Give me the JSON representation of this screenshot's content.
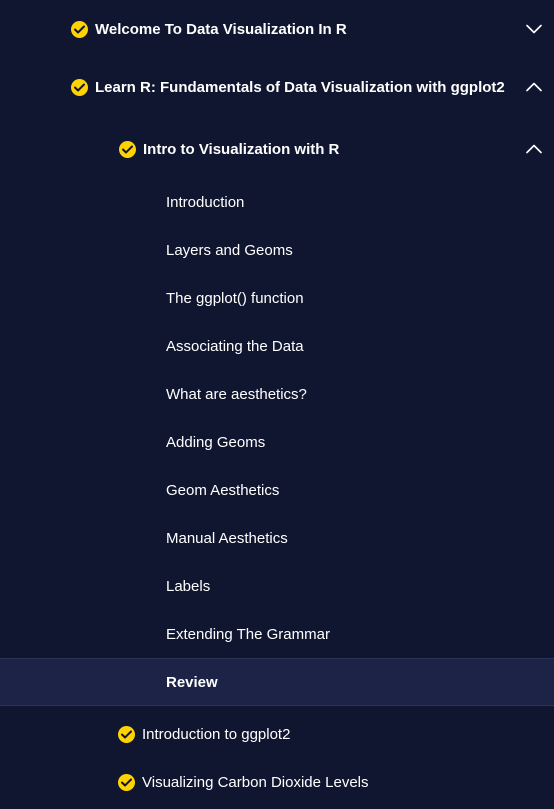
{
  "sections": [
    {
      "title": "Welcome To Data Visualization In R",
      "completed": true,
      "expanded": false,
      "icon": "chevron-down-icon"
    },
    {
      "title": "Learn R: Fundamentals of Data Visualization with ggplot2",
      "completed": true,
      "expanded": true,
      "icon": "chevron-up-icon"
    }
  ],
  "modules": [
    {
      "title": "Intro to Visualization with R",
      "completed": true,
      "expanded": true,
      "icon": "chevron-up-icon"
    },
    {
      "title": "Introduction to ggplot2",
      "completed": true,
      "expanded": false
    },
    {
      "title": "Visualizing Carbon Dioxide Levels",
      "completed": true,
      "expanded": false
    }
  ],
  "lessons": [
    {
      "label": "Introduction"
    },
    {
      "label": "Layers and Geoms"
    },
    {
      "label": "The ggplot() function"
    },
    {
      "label": "Associating the Data"
    },
    {
      "label": "What are aesthetics?"
    },
    {
      "label": "Adding Geoms"
    },
    {
      "label": "Geom Aesthetics"
    },
    {
      "label": "Manual Aesthetics"
    },
    {
      "label": "Labels"
    },
    {
      "label": "Extending The Grammar"
    },
    {
      "label": "Review",
      "active": true
    }
  ],
  "colors": {
    "background": "#10162f",
    "active_row": "#1c2346",
    "check": "#ffd300",
    "text": "#ffffff"
  }
}
